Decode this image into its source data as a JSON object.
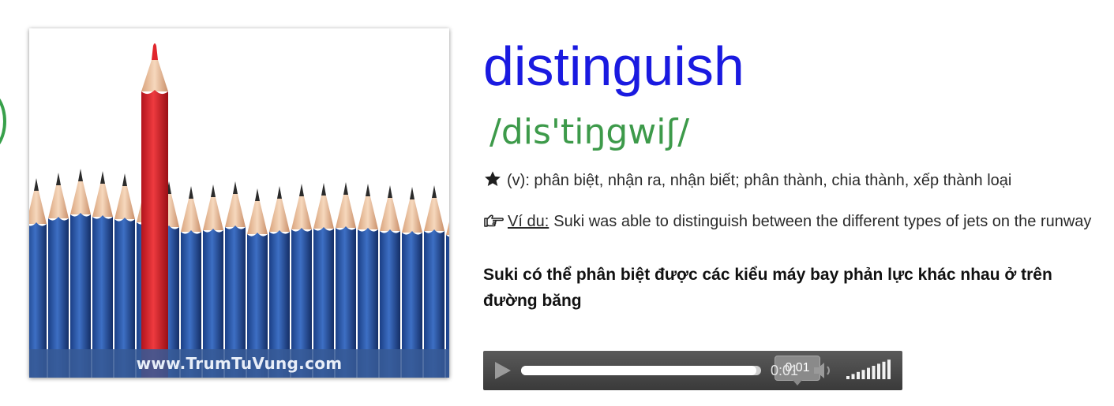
{
  "image": {
    "watermark": "www.TrumTuVung.com"
  },
  "entry": {
    "word": "distinguish",
    "pronunciation": "/dis'tiŋgwiʃ/",
    "definition": "(v): phân biệt, nhận ra, nhận biết; phân thành, chia thành, xếp thành loại",
    "example_label": "Ví du:",
    "example_text": "Suki was able to distinguish between the different types of jets on the runway",
    "translation": "Suki có thể phân biệt được các kiểu máy bay phản lực khác nhau ở trên đường băng"
  },
  "player": {
    "tooltip_time": "0:01",
    "current_time": "0:01",
    "progress": 0.98,
    "volume_level": 1.0
  },
  "colors": {
    "word": "#1a1ae0",
    "pronunciation": "#3d9a4a",
    "player_background": "#4a4a4a"
  },
  "icons": {
    "definition": "star-icon",
    "example": "pointing-hand-icon",
    "play": "play-icon",
    "mute": "speaker-icon"
  }
}
